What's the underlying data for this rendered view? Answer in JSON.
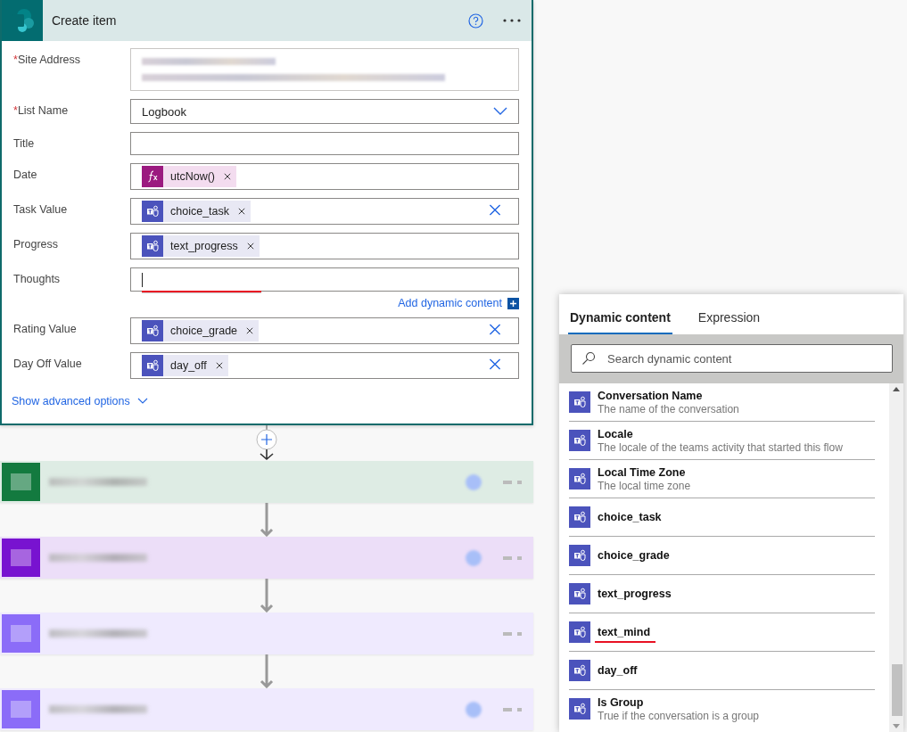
{
  "card": {
    "title": "Create item",
    "fields": [
      {
        "label": "Site Address",
        "required_mark": "*",
        "kind": "blurred"
      },
      {
        "label": "List Name",
        "required_mark": "*",
        "kind": "dropdown",
        "value": "Logbook"
      },
      {
        "label": "Title",
        "kind": "text"
      },
      {
        "label": "Date",
        "kind": "tokens",
        "clearable": false,
        "tokens": [
          {
            "kind": "expression",
            "text": "utcNow()"
          }
        ]
      },
      {
        "label": "Task Value",
        "kind": "tokens",
        "clearable": true,
        "tokens": [
          {
            "kind": "teams",
            "text": "choice_task"
          }
        ]
      },
      {
        "label": "Progress",
        "kind": "tokens",
        "clearable": false,
        "tokens": [
          {
            "kind": "teams",
            "text": "text_progress"
          }
        ]
      },
      {
        "label": "Thoughts",
        "kind": "text",
        "focused": true,
        "underlined": true,
        "link": "Add dynamic content"
      },
      {
        "label": "Rating Value",
        "kind": "tokens",
        "clearable": true,
        "tokens": [
          {
            "kind": "teams",
            "text": "choice_grade"
          }
        ]
      },
      {
        "label": "Day Off Value",
        "kind": "tokens",
        "clearable": true,
        "tokens": [
          {
            "kind": "teams",
            "text": "day_off"
          }
        ]
      }
    ],
    "advanced": "Show advanced options"
  },
  "steps": [
    {
      "color": "#137a3f",
      "menu": true
    },
    {
      "color": "#7813d0",
      "menu": true
    },
    {
      "color": "#8b6cf8",
      "menu": false
    },
    {
      "color": "#8b6cf8",
      "menu": true
    }
  ],
  "panel": {
    "tabs": [
      {
        "label": "Dynamic content",
        "selected": true
      },
      {
        "label": "Expression",
        "selected": false
      }
    ],
    "search": {
      "placeholder": "Search dynamic content"
    },
    "items": [
      {
        "name": "Conversation Name",
        "description": "The name of the conversation",
        "underlined": false
      },
      {
        "name": "Locale",
        "description": "The locale of the teams activity that started this flow",
        "underlined": false
      },
      {
        "name": "Local Time Zone",
        "description": "The local time zone",
        "underlined": false
      },
      {
        "name": "choice_task",
        "underlined": false
      },
      {
        "name": "choice_grade",
        "underlined": false
      },
      {
        "name": "text_progress",
        "underlined": false
      },
      {
        "name": "text_mind",
        "underlined": true
      },
      {
        "name": "day_off",
        "underlined": false
      },
      {
        "name": "Is Group",
        "description": "True if the conversation is a group",
        "underlined": false
      }
    ]
  }
}
